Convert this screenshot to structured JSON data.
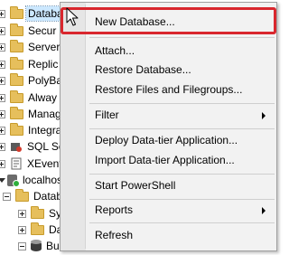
{
  "tree": {
    "items": [
      {
        "label": "Databases",
        "selected": true,
        "expander": "plus"
      },
      {
        "label": "Secur",
        "expander": "plus"
      },
      {
        "label": "Server",
        "expander": "plus"
      },
      {
        "label": "Replic",
        "expander": "plus"
      },
      {
        "label": "PolyBa",
        "expander": "plus"
      },
      {
        "label": "Alway",
        "expander": "plus"
      },
      {
        "label": "Manag",
        "expander": "plus"
      },
      {
        "label": "Integra",
        "expander": "plus"
      },
      {
        "label": "SQL Se",
        "expander": "plus"
      },
      {
        "label": "XEvent",
        "expander": "plus"
      }
    ],
    "server_label": "localhost\\",
    "sub_databases_label": "Databa",
    "children": [
      {
        "label": "Sys"
      },
      {
        "label": "Da"
      },
      {
        "label": "Bu"
      }
    ]
  },
  "context_menu": {
    "items": [
      {
        "label": "New Database...",
        "highlighted_box": true
      },
      {
        "label": "Attach..."
      },
      {
        "label": "Restore Database..."
      },
      {
        "label": "Restore Files and Filegroups..."
      },
      {
        "label": "Filter",
        "submenu": true
      },
      {
        "label": "Deploy Data-tier Application..."
      },
      {
        "label": "Import Data-tier Application..."
      },
      {
        "label": "Start PowerShell"
      },
      {
        "label": "Reports",
        "submenu": true
      },
      {
        "label": "Refresh"
      }
    ],
    "highlight_color": "#d9272e"
  },
  "icons": {
    "folder": "folder-icon",
    "server": "server-icon",
    "database": "database-icon",
    "cursor": "mouse-pointer-icon"
  }
}
